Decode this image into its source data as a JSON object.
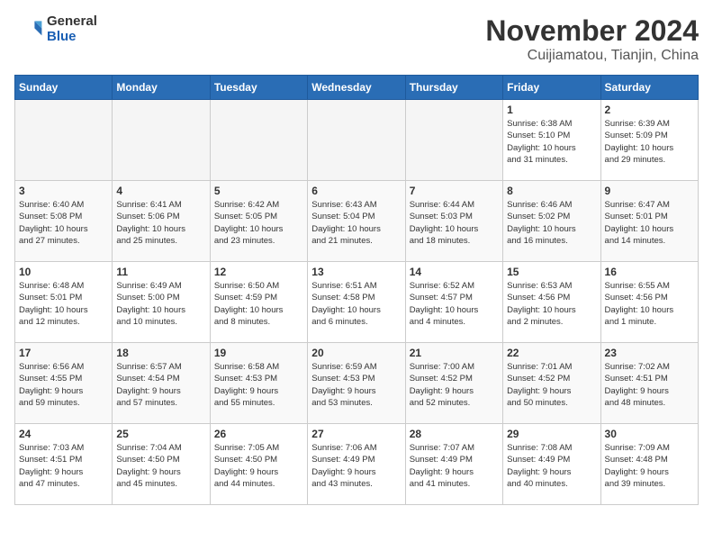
{
  "header": {
    "logo_general": "General",
    "logo_blue": "Blue",
    "title": "November 2024",
    "location": "Cuijiamatou, Tianjin, China"
  },
  "calendar": {
    "days_of_week": [
      "Sunday",
      "Monday",
      "Tuesday",
      "Wednesday",
      "Thursday",
      "Friday",
      "Saturday"
    ],
    "weeks": [
      [
        {
          "day": "",
          "info": ""
        },
        {
          "day": "",
          "info": ""
        },
        {
          "day": "",
          "info": ""
        },
        {
          "day": "",
          "info": ""
        },
        {
          "day": "",
          "info": ""
        },
        {
          "day": "1",
          "info": "Sunrise: 6:38 AM\nSunset: 5:10 PM\nDaylight: 10 hours\nand 31 minutes."
        },
        {
          "day": "2",
          "info": "Sunrise: 6:39 AM\nSunset: 5:09 PM\nDaylight: 10 hours\nand 29 minutes."
        }
      ],
      [
        {
          "day": "3",
          "info": "Sunrise: 6:40 AM\nSunset: 5:08 PM\nDaylight: 10 hours\nand 27 minutes."
        },
        {
          "day": "4",
          "info": "Sunrise: 6:41 AM\nSunset: 5:06 PM\nDaylight: 10 hours\nand 25 minutes."
        },
        {
          "day": "5",
          "info": "Sunrise: 6:42 AM\nSunset: 5:05 PM\nDaylight: 10 hours\nand 23 minutes."
        },
        {
          "day": "6",
          "info": "Sunrise: 6:43 AM\nSunset: 5:04 PM\nDaylight: 10 hours\nand 21 minutes."
        },
        {
          "day": "7",
          "info": "Sunrise: 6:44 AM\nSunset: 5:03 PM\nDaylight: 10 hours\nand 18 minutes."
        },
        {
          "day": "8",
          "info": "Sunrise: 6:46 AM\nSunset: 5:02 PM\nDaylight: 10 hours\nand 16 minutes."
        },
        {
          "day": "9",
          "info": "Sunrise: 6:47 AM\nSunset: 5:01 PM\nDaylight: 10 hours\nand 14 minutes."
        }
      ],
      [
        {
          "day": "10",
          "info": "Sunrise: 6:48 AM\nSunset: 5:01 PM\nDaylight: 10 hours\nand 12 minutes."
        },
        {
          "day": "11",
          "info": "Sunrise: 6:49 AM\nSunset: 5:00 PM\nDaylight: 10 hours\nand 10 minutes."
        },
        {
          "day": "12",
          "info": "Sunrise: 6:50 AM\nSunset: 4:59 PM\nDaylight: 10 hours\nand 8 minutes."
        },
        {
          "day": "13",
          "info": "Sunrise: 6:51 AM\nSunset: 4:58 PM\nDaylight: 10 hours\nand 6 minutes."
        },
        {
          "day": "14",
          "info": "Sunrise: 6:52 AM\nSunset: 4:57 PM\nDaylight: 10 hours\nand 4 minutes."
        },
        {
          "day": "15",
          "info": "Sunrise: 6:53 AM\nSunset: 4:56 PM\nDaylight: 10 hours\nand 2 minutes."
        },
        {
          "day": "16",
          "info": "Sunrise: 6:55 AM\nSunset: 4:56 PM\nDaylight: 10 hours\nand 1 minute."
        }
      ],
      [
        {
          "day": "17",
          "info": "Sunrise: 6:56 AM\nSunset: 4:55 PM\nDaylight: 9 hours\nand 59 minutes."
        },
        {
          "day": "18",
          "info": "Sunrise: 6:57 AM\nSunset: 4:54 PM\nDaylight: 9 hours\nand 57 minutes."
        },
        {
          "day": "19",
          "info": "Sunrise: 6:58 AM\nSunset: 4:53 PM\nDaylight: 9 hours\nand 55 minutes."
        },
        {
          "day": "20",
          "info": "Sunrise: 6:59 AM\nSunset: 4:53 PM\nDaylight: 9 hours\nand 53 minutes."
        },
        {
          "day": "21",
          "info": "Sunrise: 7:00 AM\nSunset: 4:52 PM\nDaylight: 9 hours\nand 52 minutes."
        },
        {
          "day": "22",
          "info": "Sunrise: 7:01 AM\nSunset: 4:52 PM\nDaylight: 9 hours\nand 50 minutes."
        },
        {
          "day": "23",
          "info": "Sunrise: 7:02 AM\nSunset: 4:51 PM\nDaylight: 9 hours\nand 48 minutes."
        }
      ],
      [
        {
          "day": "24",
          "info": "Sunrise: 7:03 AM\nSunset: 4:51 PM\nDaylight: 9 hours\nand 47 minutes."
        },
        {
          "day": "25",
          "info": "Sunrise: 7:04 AM\nSunset: 4:50 PM\nDaylight: 9 hours\nand 45 minutes."
        },
        {
          "day": "26",
          "info": "Sunrise: 7:05 AM\nSunset: 4:50 PM\nDaylight: 9 hours\nand 44 minutes."
        },
        {
          "day": "27",
          "info": "Sunrise: 7:06 AM\nSunset: 4:49 PM\nDaylight: 9 hours\nand 43 minutes."
        },
        {
          "day": "28",
          "info": "Sunrise: 7:07 AM\nSunset: 4:49 PM\nDaylight: 9 hours\nand 41 minutes."
        },
        {
          "day": "29",
          "info": "Sunrise: 7:08 AM\nSunset: 4:49 PM\nDaylight: 9 hours\nand 40 minutes."
        },
        {
          "day": "30",
          "info": "Sunrise: 7:09 AM\nSunset: 4:48 PM\nDaylight: 9 hours\nand 39 minutes."
        }
      ]
    ]
  }
}
